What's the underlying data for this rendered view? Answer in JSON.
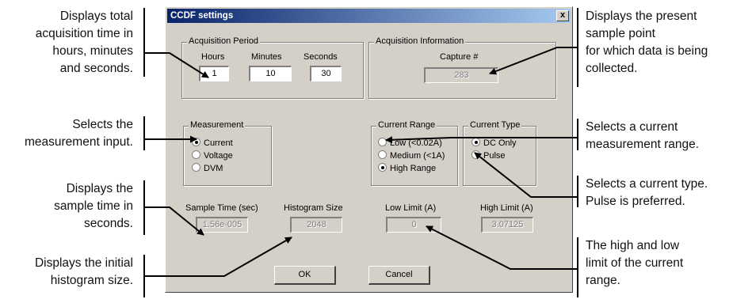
{
  "dialog": {
    "title": "CCDF settings",
    "close_glyph": "x",
    "acquisition_period": {
      "legend": "Acquisition Period",
      "hours_label": "Hours",
      "hours_value": "1",
      "minutes_label": "Minutes",
      "minutes_value": "10",
      "seconds_label": "Seconds",
      "seconds_value": "30"
    },
    "acquisition_info": {
      "legend": "Acquisition Information",
      "capture_label": "Capture #",
      "capture_value": "283"
    },
    "measurement": {
      "legend": "Measurement",
      "options": [
        "Current",
        "Voltage",
        "DVM"
      ],
      "selected": "Current"
    },
    "current_range": {
      "legend": "Current Range",
      "options": [
        "Low (<0.02A)",
        "Medium (<1A)",
        "High Range"
      ],
      "selected": "High Range"
    },
    "current_type": {
      "legend": "Current Type",
      "options": [
        "DC Only",
        "Pulse"
      ],
      "selected": "DC Only"
    },
    "sample_time": {
      "label": "Sample Time (sec)",
      "value": "1.56e-005"
    },
    "histogram_size": {
      "label": "Histogram Size",
      "value": "2048"
    },
    "low_limit": {
      "label": "Low Limit (A)",
      "value": "0"
    },
    "high_limit": {
      "label": "High Limit (A)",
      "value": "3.07125"
    },
    "ok_label": "OK",
    "cancel_label": "Cancel"
  },
  "annotations": {
    "total_time": [
      "Displays total",
      "acquisition time in",
      "hours, minutes",
      "and seconds."
    ],
    "measurement_input": [
      "Selects the",
      "measurement input."
    ],
    "sample_time": [
      "Displays the",
      "sample time in",
      "seconds."
    ],
    "histogram_size": [
      "Displays the initial",
      "histogram size."
    ],
    "sample_point": [
      "Displays the present",
      "sample point",
      "for which data is being",
      "collected."
    ],
    "current_range": [
      "Selects a current",
      "measurement range."
    ],
    "current_type": [
      "Selects a current type.",
      "Pulse is preferred."
    ],
    "limits": [
      "The high and low",
      "limit of the current",
      "range."
    ]
  }
}
